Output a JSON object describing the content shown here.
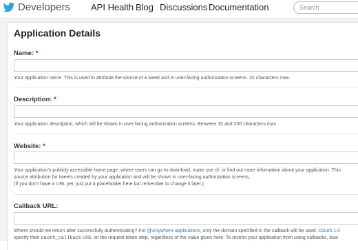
{
  "header": {
    "brand": "Developers",
    "nav": [
      "API Health",
      "Blog",
      "Discussions",
      "Documentation"
    ],
    "search_placeholder": "Search"
  },
  "form": {
    "title": "Application Details",
    "fields": [
      {
        "label": "Name:",
        "required": "*",
        "help": [
          "Your application name. This is used to attribute the source of a tweet and in user-facing authorization screens. 32 characters max."
        ]
      },
      {
        "label": "Description:",
        "required": "*",
        "help": [
          "Your application description, which will be shown in user-facing authorization screens. Between 10 and 200 characters max."
        ]
      },
      {
        "label": "Website:",
        "required": "*",
        "help": [
          "Your application's publicly accessible home page, where users can go to download, make use of, or find out more information about your application. This",
          "source attribution for tweets created by your application and will be shown in user-facing authorization screens.",
          "(If you don't have a URL yet, just put a placeholder here but remember to change it later.)"
        ]
      },
      {
        "label": "Callback URL:",
        "required": "",
        "help_line1": {
          "pre": "Where should we return after successfully authenticating? For ",
          "link1": "@Anywhere applications",
          "mid": ", only the domain specified in the callback will be used. ",
          "link2": "OAuth 1.0"
        },
        "help_line2": {
          "pre": "specify their ",
          "code": "oauth_callback",
          "post": " URL on the request token step, regardless of the value given here. To restrict your application from using callbacks, leav"
        }
      }
    ]
  }
}
